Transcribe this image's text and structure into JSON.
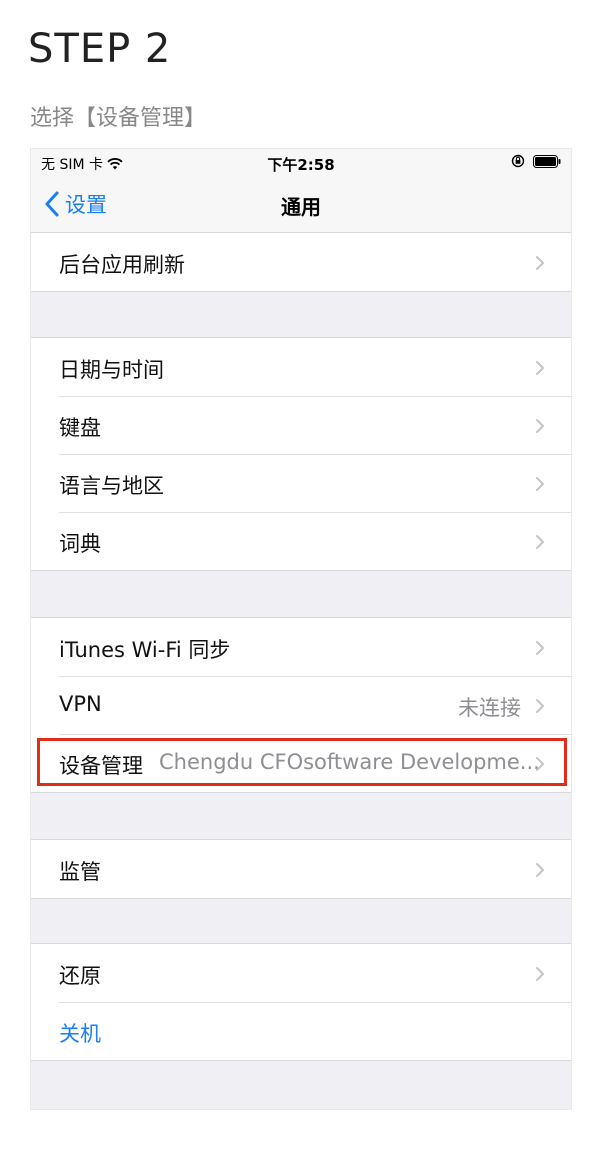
{
  "header": {
    "step_title": "STEP 2",
    "instruction": "选择【设备管理】"
  },
  "status_bar": {
    "carrier": "无 SIM 卡",
    "time": "下午2:58",
    "icons": [
      "wifi-icon",
      "orientation-lock-icon",
      "battery-icon"
    ]
  },
  "nav": {
    "back_label": "设置",
    "title": "通用"
  },
  "groups": [
    {
      "rows": [
        {
          "label": "后台应用刷新"
        }
      ]
    },
    {
      "rows": [
        {
          "label": "日期与时间"
        },
        {
          "label": "键盘"
        },
        {
          "label": "语言与地区"
        },
        {
          "label": "词典"
        }
      ]
    },
    {
      "rows": [
        {
          "label": "iTunes Wi-Fi 同步"
        },
        {
          "label": "VPN",
          "value": "未连接"
        },
        {
          "label": "设备管理",
          "detail": "Chengdu CFOsoftware Developme..."
        }
      ]
    },
    {
      "rows": [
        {
          "label": "监管"
        }
      ]
    },
    {
      "rows": [
        {
          "label": "还原"
        },
        {
          "label": "关机"
        }
      ]
    }
  ],
  "colors": {
    "accent": "#1a7ef5",
    "highlight": "#e12d1e",
    "grouped_background": "#efeff4"
  }
}
